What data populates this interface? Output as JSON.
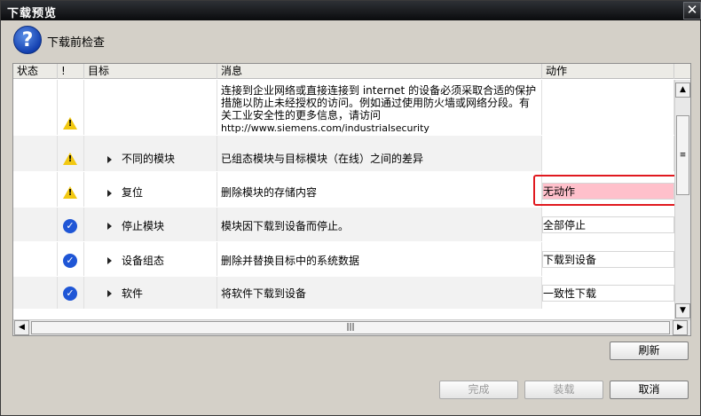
{
  "window": {
    "title": "下载预览",
    "close_glyph": "✕"
  },
  "header": {
    "icon_glyph": "?",
    "title": "下载前检查"
  },
  "columns": {
    "status": "状态",
    "bang": "!",
    "target": "目标",
    "message": "消息",
    "action": "动作"
  },
  "rows": [
    {
      "icon": "warning-icon",
      "target": "",
      "message_lines": [
        "连接到企业网络或直接连接到 internet 的设备必须采取合适的保护",
        "措施以防止未经授权的访问。例如通过使用防火墙或网络分段。有",
        "关工业安全性的更多信息，请访问",
        "http://www.siemens.com/industrialsecurity"
      ],
      "action": ""
    },
    {
      "icon": "warning-icon",
      "target": "不同的模块",
      "message": "已组态模块与目标模块（在线）之间的差异",
      "action": ""
    },
    {
      "icon": "warning-icon",
      "target": "复位",
      "message": "删除模块的存储内容",
      "action": "无动作"
    },
    {
      "icon": "check-icon",
      "target": "停止模块",
      "message": "模块因下载到设备而停止。",
      "action": "全部停止"
    },
    {
      "icon": "check-icon",
      "target": "设备组态",
      "message": "删除并替换目标中的系统数据",
      "action": "下载到设备"
    },
    {
      "icon": "check-icon",
      "target": "软件",
      "message": "将软件下载到设备",
      "action": "一致性下载"
    }
  ],
  "scroll": {
    "up": "▲",
    "down": "▼",
    "left": "◀",
    "right": "▶",
    "grip_v": "≡",
    "grip_h": "|||"
  },
  "buttons": {
    "refresh": "刷新",
    "finish": "完成",
    "load": "装载",
    "cancel": "取消"
  },
  "colors": {
    "highlight_action": "#ffc0cb",
    "annotation_box": "#e0191f"
  }
}
